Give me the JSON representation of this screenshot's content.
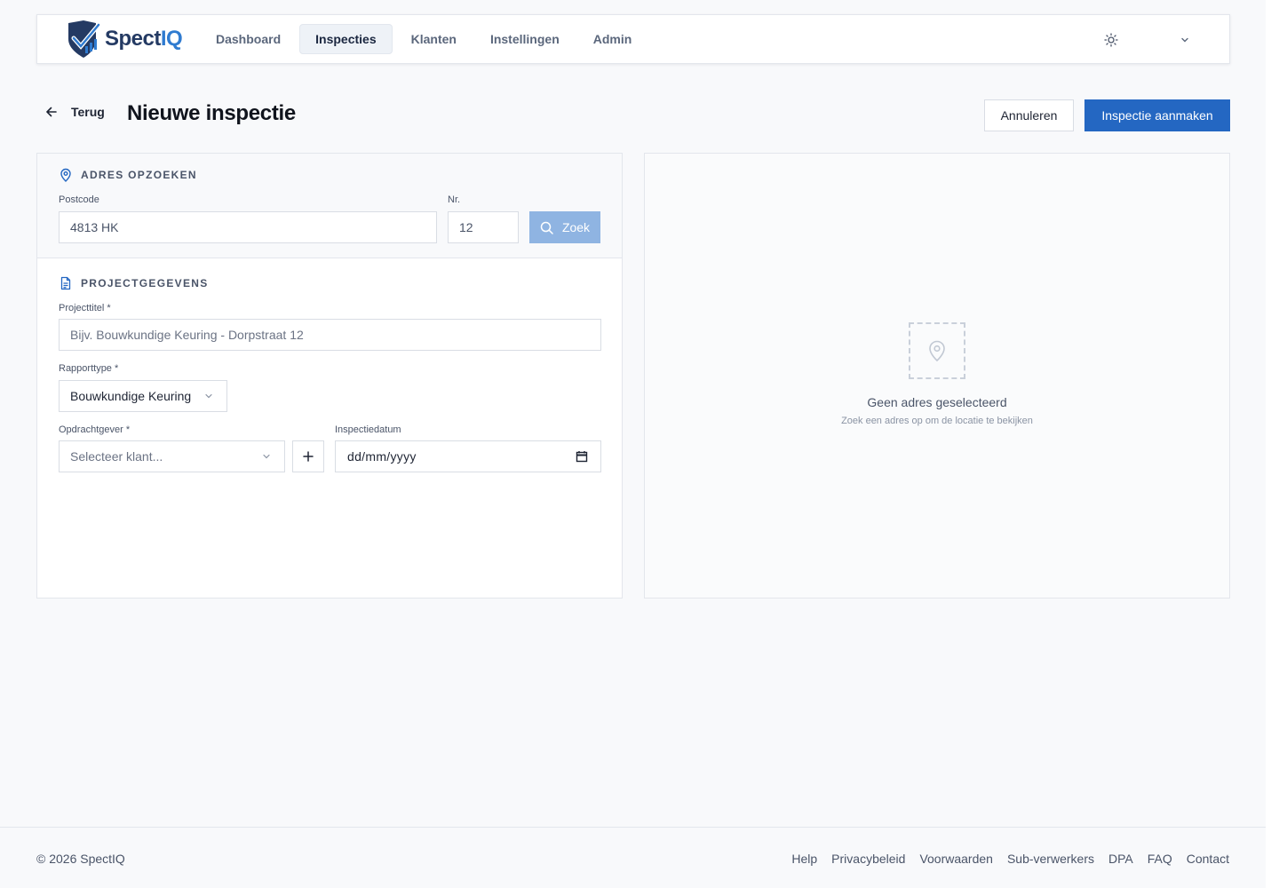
{
  "brand": {
    "name_part1": "Spect",
    "name_part2": "IQ",
    "primary_color": "#2467c2",
    "logo_dark": "#243a63",
    "logo_light": "#2f7bd0"
  },
  "nav": {
    "items": [
      {
        "label": "Dashboard",
        "active": false
      },
      {
        "label": "Inspecties",
        "active": true
      },
      {
        "label": "Klanten",
        "active": false
      },
      {
        "label": "Instellingen",
        "active": false
      },
      {
        "label": "Admin",
        "active": false
      }
    ],
    "theme_icon": "sun-icon",
    "user_menu_icon": "chevron-down-icon"
  },
  "header": {
    "back_label": "Terug",
    "title": "Nieuwe inspectie",
    "cancel_label": "Annuleren",
    "create_label": "Inspectie aanmaken"
  },
  "address_search": {
    "heading": "ADRES OPZOEKEN",
    "icon": "map-pin-icon",
    "postcode_label": "Postcode",
    "postcode_value": "4813 HK",
    "number_label": "Nr.",
    "number_value": "12",
    "search_button_label": "Zoek"
  },
  "project": {
    "heading": "PROJECTGEGEVENS",
    "icon": "document-icon",
    "title_label": "Projecttitel *",
    "title_placeholder": "Bijv. Bouwkundige Keuring - Dorpstraat 12",
    "report_type_label": "Rapporttype *",
    "report_type_value": "Bouwkundige Keuring",
    "client_label": "Opdrachtgever *",
    "client_placeholder": "Selecteer klant...",
    "date_label": "Inspectiedatum",
    "date_value": "dd/mm/yyyy"
  },
  "map": {
    "empty_title": "Geen adres geselecteerd",
    "empty_subtitle": "Zoek een adres op om de locatie te bekijken"
  },
  "footer": {
    "copyright": "© 2026 SpectIQ",
    "links": [
      "Help",
      "Privacybeleid",
      "Voorwaarden",
      "Sub-verwerkers",
      "DPA",
      "FAQ",
      "Contact"
    ]
  }
}
